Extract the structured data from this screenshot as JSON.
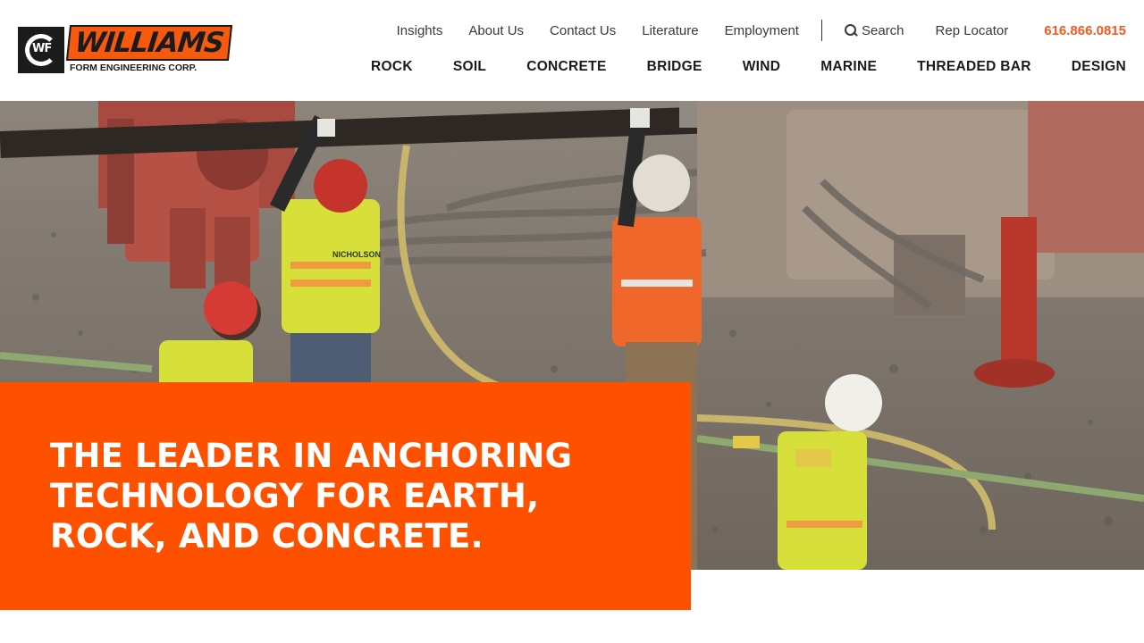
{
  "brand": {
    "logo_mark": "WF",
    "logo_word": "WILLIAMS",
    "logo_sub": "FORM ENGINEERING CORP.",
    "accent_color": "#fd5100"
  },
  "utility_nav": {
    "links": [
      "Insights",
      "About Us",
      "Contact Us",
      "Literature",
      "Employment"
    ],
    "search_label": "Search",
    "rep_locator": "Rep Locator",
    "phone": "616.866.0815"
  },
  "main_nav": [
    "ROCK",
    "SOIL",
    "CONCRETE",
    "BRIDGE",
    "WIND",
    "MARINE",
    "THREADED BAR",
    "DESIGN"
  ],
  "hero": {
    "headline": "THE LEADER IN ANCHORING TECHNOLOGY FOR EARTH, ROCK, AND CONCRETE.",
    "vest_text": "NICHOLSON"
  },
  "icons": {
    "search": "search-icon"
  }
}
